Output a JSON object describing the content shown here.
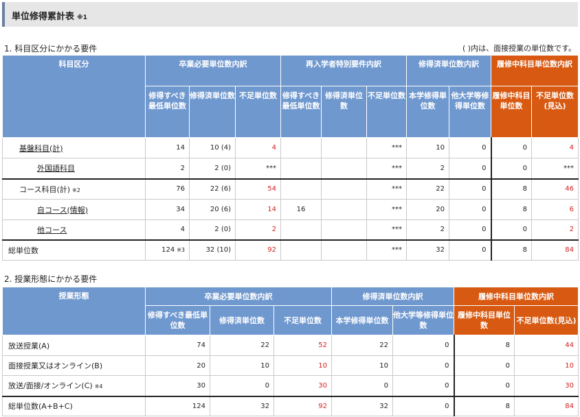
{
  "title": "単位修得累計表",
  "title_note": "※1",
  "section1": {
    "heading": "1. 科目区分にかかる要件",
    "note": "( )内は、面接授業の単位数です。",
    "headers": {
      "col0": "科目区分",
      "group1": "卒業必要単位数内訳",
      "group2": "再入学者特別要件内訳",
      "group3": "修得済単位数内訳",
      "group4": "履修中科目単位数内訳",
      "sub": [
        "修得すべき最低単位数",
        "修得済単位数",
        "不足単位数",
        "修得すべき最低単位数",
        "修得済単位数",
        "不足単位数",
        "本学修得単位数",
        "他大学等修得単位数",
        "履修中科目単位数",
        "不足単位数(見込)"
      ]
    },
    "rows": [
      {
        "label": "基盤科目(計)",
        "note": "",
        "cells": [
          "14",
          "10 (4)",
          "4",
          "",
          "",
          "***",
          "10",
          "0",
          "0",
          "4"
        ]
      },
      {
        "label": "外国語科目",
        "note": "",
        "cells": [
          "2",
          "2 (0)",
          "***",
          "",
          "",
          "***",
          "2",
          "0",
          "0",
          "***"
        ]
      },
      {
        "label": "コース科目(計)",
        "note": "※2",
        "cells": [
          "76",
          "22 (6)",
          "54",
          "",
          "",
          "***",
          "22",
          "0",
          "8",
          "46"
        ]
      },
      {
        "label": "自コース(情報)",
        "note": "",
        "cells": [
          "34",
          "20 (6)",
          "14",
          "16",
          "",
          "***",
          "20",
          "0",
          "8",
          "6"
        ]
      },
      {
        "label": "他コース",
        "note": "",
        "cells": [
          "4",
          "2 (0)",
          "2",
          "",
          "",
          "***",
          "2",
          "0",
          "0",
          "2"
        ]
      },
      {
        "label": "総単位数",
        "note": "",
        "first_note": "※3",
        "cells": [
          "124",
          "32 (10)",
          "92",
          "",
          "",
          "***",
          "32",
          "0",
          "8",
          "84"
        ]
      }
    ]
  },
  "section2": {
    "heading": "2. 授業形態にかかる要件",
    "headers": {
      "col0": "授業形態",
      "group1": "卒業必要単位数内訳",
      "group2": "修得済単位数内訳",
      "group3": "履修中科目単位数内訳",
      "sub": [
        "修得すべき最低単位数",
        "修得済単位数",
        "不足単位数",
        "本学修得単位数",
        "他大学等修得単位数",
        "履修中科目単位数",
        "不足単位数(見込)"
      ]
    },
    "rows": [
      {
        "label": "放送授業(A)",
        "note": "",
        "cells": [
          "74",
          "22",
          "52",
          "22",
          "0",
          "8",
          "44"
        ]
      },
      {
        "label": "面接授業又はオンライン(B)",
        "note": "",
        "cells": [
          "20",
          "10",
          "10",
          "10",
          "0",
          "0",
          "10"
        ]
      },
      {
        "label": "放送/面接/オンライン(C)",
        "note": "※4",
        "cells": [
          "30",
          "0",
          "30",
          "0",
          "0",
          "0",
          "30"
        ]
      },
      {
        "label": "総単位数(A+B+C)",
        "note": "",
        "cells": [
          "124",
          "32",
          "92",
          "32",
          "0",
          "8",
          "84"
        ]
      }
    ]
  },
  "colors": {
    "header_blue": "#6f98cf",
    "header_orange": "#d85a12",
    "shortfall_red": "#d51f1f"
  }
}
